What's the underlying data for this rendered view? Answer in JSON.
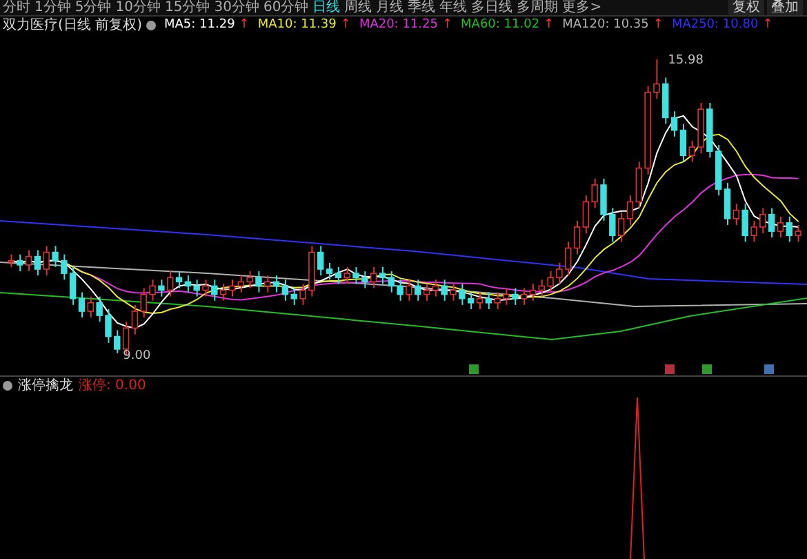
{
  "menu": {
    "items": [
      {
        "label": "分时",
        "selected": false
      },
      {
        "label": "1分钟",
        "selected": false
      },
      {
        "label": "5分钟",
        "selected": false
      },
      {
        "label": "10分钟",
        "selected": false
      },
      {
        "label": "15分钟",
        "selected": false
      },
      {
        "label": "30分钟",
        "selected": false
      },
      {
        "label": "60分钟",
        "selected": false
      },
      {
        "label": "日线",
        "selected": true
      },
      {
        "label": "周线",
        "selected": false
      },
      {
        "label": "月线",
        "selected": false
      },
      {
        "label": "季线",
        "selected": false
      },
      {
        "label": "年线",
        "selected": false
      },
      {
        "label": "多日线",
        "selected": false
      },
      {
        "label": "多周期",
        "selected": false
      },
      {
        "label": "更多>",
        "selected": false
      }
    ],
    "buttons": [
      "复权",
      "叠加"
    ]
  },
  "chart": {
    "title": "双力医疗(日线 前复权)",
    "ma": [
      {
        "label": "MA5: 11.29",
        "arrow": "↑",
        "color": "#ffffff"
      },
      {
        "label": "MA10: 11.39",
        "arrow": "↑",
        "color": "#e8e830"
      },
      {
        "label": "MA20: 11.25",
        "arrow": "↑",
        "color": "#e030e0"
      },
      {
        "label": "MA60: 11.02",
        "arrow": "↑",
        "color": "#20c020"
      },
      {
        "label": "MA120: 10.35",
        "arrow": "↑",
        "color": "#b0b0b0"
      },
      {
        "label": "MA250: 10.80",
        "arrow": "↑",
        "color": "#3030ff"
      }
    ],
    "high_label": "15.98",
    "low_label": "9.00",
    "signals": [
      {
        "color": "#2e9a2e"
      },
      {
        "color": "#b03040"
      },
      {
        "color": "#2e9a2e"
      },
      {
        "color": "#4070b0"
      }
    ]
  },
  "indicator": {
    "title": "涨停擒龙",
    "readings": [
      {
        "label": "涨停: 0.00",
        "color": "#e02020"
      }
    ]
  }
}
